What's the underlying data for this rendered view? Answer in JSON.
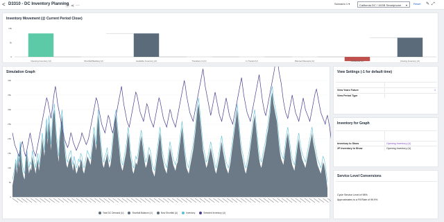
{
  "header": {
    "back_glyph": "<",
    "title": "D3310 - DC Inventory Planning",
    "icons": [
      "info-icon",
      "share-icon",
      "more-icon"
    ],
    "scenario_label": "Scenario 1",
    "dc_selector": "California DC / 16GB Smartphone",
    "reset_label": "Reset",
    "tool_icons": [
      "edit-icon",
      "expand-icon"
    ]
  },
  "inventory_movement": {
    "title": "Inventory Movement (@ Current Period Close)",
    "chart_data": {
      "type": "bar",
      "categories": [
        "Opening Inventory (U)",
        "Shortfall Backlog (U)",
        "Available Inventory (U)",
        "Transfers In (U)",
        "In Transit (U)",
        "Planned Receipts (U)",
        "Outbound (U)",
        "Closing Inventory (U)"
      ],
      "values": [
        330,
        0,
        330,
        0,
        0,
        0,
        -60,
        270
      ],
      "ylim": [
        0,
        400
      ],
      "yticks": [
        "0",
        "5k",
        "10k"
      ],
      "colors": [
        "#5cc9a7",
        "#5cc9a7",
        "#5b6b7a",
        "#5b6b7a",
        "#5b6b7a",
        "#5b6b7a",
        "#c0504d",
        "#5b6b7a"
      ]
    }
  },
  "simulation": {
    "title": "Simulation Graph",
    "chart_data": {
      "type": "area",
      "yticks": [
        "0",
        "5k",
        "10k",
        "15k",
        "20k",
        "25k",
        "30k",
        "35k",
        "40k"
      ],
      "ylim": [
        0,
        40
      ],
      "series_area": [
        4,
        6,
        9,
        12,
        8,
        14,
        10,
        18,
        13,
        9,
        7,
        6,
        12,
        15,
        11,
        8,
        10,
        9,
        14,
        12,
        10,
        8,
        11,
        13,
        9,
        12,
        15,
        20,
        17,
        14,
        21,
        25,
        18,
        26,
        22,
        16,
        23,
        28,
        30,
        24,
        19,
        15,
        12,
        20,
        24,
        28,
        22,
        18,
        14,
        11,
        10,
        12,
        13,
        14,
        11,
        9,
        12,
        10,
        8,
        9,
        11,
        10,
        13,
        12,
        9,
        8,
        10,
        12,
        14,
        13,
        12,
        11,
        15,
        18,
        22,
        19,
        16,
        24,
        28,
        22,
        18,
        14,
        11,
        10,
        12,
        13,
        15,
        12,
        10,
        11,
        14,
        18,
        22,
        26,
        28,
        24,
        20,
        16,
        12,
        10,
        9,
        11,
        13,
        15,
        18,
        22,
        19,
        14,
        12,
        9,
        8,
        10,
        12,
        11,
        13,
        16,
        19,
        21,
        18,
        15,
        12,
        10,
        11,
        13,
        15,
        14,
        12,
        9,
        8,
        7,
        10,
        13,
        16,
        19,
        22,
        18,
        14,
        12,
        10,
        9,
        8,
        11,
        14,
        17,
        15,
        13,
        11,
        10,
        9,
        11,
        12,
        15,
        18,
        21,
        24,
        20,
        16,
        13,
        10,
        9,
        8,
        10,
        12,
        14,
        16,
        19,
        22,
        26,
        30,
        32,
        28,
        24,
        20,
        16,
        14,
        12,
        10,
        11,
        13,
        15,
        17,
        15,
        13,
        11,
        9,
        8,
        10,
        12,
        14,
        17,
        19,
        16,
        14,
        12,
        10,
        9,
        8,
        10,
        12,
        15,
        18,
        21,
        24,
        27,
        30,
        26,
        22,
        18,
        15,
        13,
        11,
        9,
        8,
        10,
        12,
        14,
        17,
        20,
        23,
        26,
        28,
        24,
        20,
        16,
        13,
        11,
        10,
        12,
        14,
        16,
        18,
        21,
        23,
        26,
        29,
        34,
        36,
        32,
        30,
        28,
        26,
        22,
        18,
        15,
        13,
        12,
        11,
        14,
        17,
        20,
        22,
        19,
        16,
        13,
        11,
        10,
        9,
        12,
        15,
        18,
        20,
        17,
        15,
        13,
        12,
        11,
        10,
        12,
        14,
        16,
        18,
        20,
        22,
        19,
        17,
        15,
        13,
        11,
        10,
        9,
        8,
        10,
        12,
        11,
        9,
        6,
        3
      ],
      "series_line_light": [
        6,
        8,
        10,
        13,
        10,
        15,
        12,
        19,
        15,
        11,
        9,
        8,
        13,
        16,
        13,
        10,
        12,
        11,
        16,
        14,
        12,
        10,
        13,
        15,
        11,
        14,
        17,
        22,
        19,
        16,
        23,
        27,
        20,
        28,
        24,
        18,
        25,
        30,
        32,
        26,
        21,
        17,
        14,
        22,
        26,
        30,
        24,
        20,
        16,
        13,
        12,
        14,
        15,
        16,
        13,
        11,
        14,
        12,
        10,
        11,
        13,
        12,
        15,
        14,
        11,
        10,
        12,
        14,
        16,
        15,
        14,
        13,
        17,
        20,
        24,
        21,
        18,
        26,
        30,
        24,
        20,
        16,
        13,
        12,
        14,
        15,
        17,
        14,
        12,
        13,
        16,
        20,
        24,
        28,
        30,
        26,
        22,
        18,
        14,
        12,
        11,
        13,
        15,
        17,
        20,
        24,
        21,
        16,
        14,
        11,
        10,
        12,
        14,
        13,
        15,
        18,
        21,
        23,
        20,
        17,
        14,
        12,
        13,
        15,
        17,
        16,
        14,
        11,
        10,
        9,
        12,
        15,
        18,
        21,
        24,
        20,
        16,
        14,
        12,
        11,
        10,
        13,
        16,
        19,
        17,
        15,
        13,
        12,
        11,
        13,
        14,
        17,
        20,
        23,
        26,
        22,
        18,
        15,
        12,
        11,
        10,
        12,
        14,
        16,
        18,
        21,
        24,
        28,
        32,
        34,
        30,
        26,
        22,
        18,
        16,
        14,
        12,
        13,
        15,
        17,
        19,
        17,
        15,
        13,
        11,
        10,
        12,
        14,
        16,
        19,
        21,
        18,
        16,
        14,
        12,
        11,
        10,
        12,
        14,
        17,
        20,
        23,
        26,
        29,
        32,
        28,
        24,
        20,
        17,
        15,
        13,
        11,
        10,
        12,
        14,
        16,
        19,
        22,
        25,
        28,
        30,
        26,
        22,
        18,
        15,
        13,
        12,
        14,
        16,
        18,
        20,
        23,
        25,
        28,
        31,
        36,
        38,
        34,
        32,
        30,
        28,
        24,
        20,
        17,
        15,
        14,
        13,
        16,
        19,
        22,
        24,
        21,
        18,
        15,
        13,
        12,
        11,
        14,
        17,
        20,
        22,
        19,
        17,
        15,
        14,
        13,
        12,
        14,
        16,
        18,
        20,
        22,
        24,
        21,
        19,
        17,
        15,
        13,
        12,
        11,
        10,
        12,
        14,
        13,
        11,
        8,
        5
      ],
      "series_line_dark": [
        22,
        20,
        18,
        17,
        16,
        15,
        14,
        16,
        18,
        19,
        17,
        15,
        14,
        16,
        18,
        20,
        22,
        20,
        18,
        16,
        15,
        14,
        16,
        18,
        20,
        22,
        24,
        26,
        28,
        30,
        32,
        34,
        33,
        31,
        29,
        27,
        30,
        33,
        36,
        38,
        35,
        32,
        30,
        28,
        26,
        24,
        22,
        20,
        19,
        18,
        17,
        18,
        20,
        22,
        21,
        19,
        18,
        17,
        16,
        17,
        18,
        19,
        20,
        22,
        21,
        20,
        19,
        18,
        19,
        20,
        22,
        24,
        26,
        28,
        30,
        32,
        34,
        33,
        31,
        29,
        27,
        25,
        24,
        23,
        22,
        24,
        26,
        28,
        27,
        25,
        23,
        22,
        24,
        26,
        28,
        30,
        32,
        34,
        36,
        38,
        35,
        32,
        30,
        28,
        26,
        25,
        24,
        26,
        28,
        30,
        32,
        34,
        36,
        35,
        33,
        31,
        29,
        28,
        27,
        26,
        28,
        30,
        32,
        31,
        29,
        27,
        26,
        25,
        24,
        26,
        28,
        30,
        32,
        34,
        33,
        31,
        29,
        27,
        26,
        25,
        24,
        26,
        28,
        30,
        29,
        27,
        26,
        25,
        24,
        26,
        28,
        30,
        32,
        34,
        36,
        38,
        40,
        38,
        35,
        33,
        31,
        29,
        28,
        27,
        26,
        28,
        30,
        32,
        34,
        36,
        38,
        40,
        42,
        44,
        41,
        38,
        36,
        34,
        32,
        30,
        28,
        30,
        32,
        34,
        36,
        34,
        32,
        30,
        28,
        27,
        26,
        28,
        30,
        32,
        34,
        32,
        30,
        28,
        27,
        26,
        25,
        27,
        29,
        31,
        33,
        35,
        37,
        39,
        41,
        38,
        35,
        33,
        31,
        29,
        28,
        27,
        26,
        28,
        30,
        32,
        34,
        36,
        38,
        40,
        42,
        39,
        36,
        33,
        31,
        29,
        28,
        30,
        32,
        34,
        36,
        38,
        40,
        42,
        44,
        48,
        50,
        46,
        43,
        41,
        39,
        36,
        33,
        31,
        29,
        28,
        27,
        29,
        31,
        33,
        35,
        33,
        31,
        29,
        28,
        27,
        26,
        28,
        30,
        32,
        34,
        32,
        30,
        29,
        28,
        27,
        26,
        28,
        30,
        32,
        34,
        36,
        37,
        35,
        33,
        31,
        29,
        28,
        27,
        26,
        25,
        27,
        28,
        26,
        24,
        21,
        18
      ],
      "series": [
        {
          "name": "Total DC Demand (U)",
          "color": "#5b6b7a"
        },
        {
          "name": "Shortfall Balance (U)",
          "color": "#5b6b7a"
        },
        {
          "name": "New Shortfall (U)",
          "color": "#5b6b7a"
        },
        {
          "name": "Inventory",
          "color": "#5bbfd6"
        },
        {
          "name": "Selected Inventory (U)",
          "color": "#4a3d8f"
        }
      ]
    }
  },
  "view_settings": {
    "title": "View Settings (-1 for default time)",
    "rows": [
      {
        "label": "",
        "value": ""
      },
      {
        "label": "View Years Future",
        "value": "",
        "tick": "1"
      },
      {
        "label": "View Period Type",
        "value": ""
      }
    ]
  },
  "inventory_for_graph": {
    "title": "Inventory for Graph",
    "rows": [
      {
        "label": "",
        "value": ""
      },
      {
        "label": "Inventory to Show",
        "value": "Opening Inventory (U)"
      },
      {
        "label": "2P Inventory to Show",
        "value": "Opening Inventory (U)"
      }
    ]
  },
  "service_level": {
    "title": "Service Level Conversions",
    "lines": [
      "Cycle Service Level of 98%",
      "Approximates to a Fill Rate of 99.9%"
    ]
  }
}
